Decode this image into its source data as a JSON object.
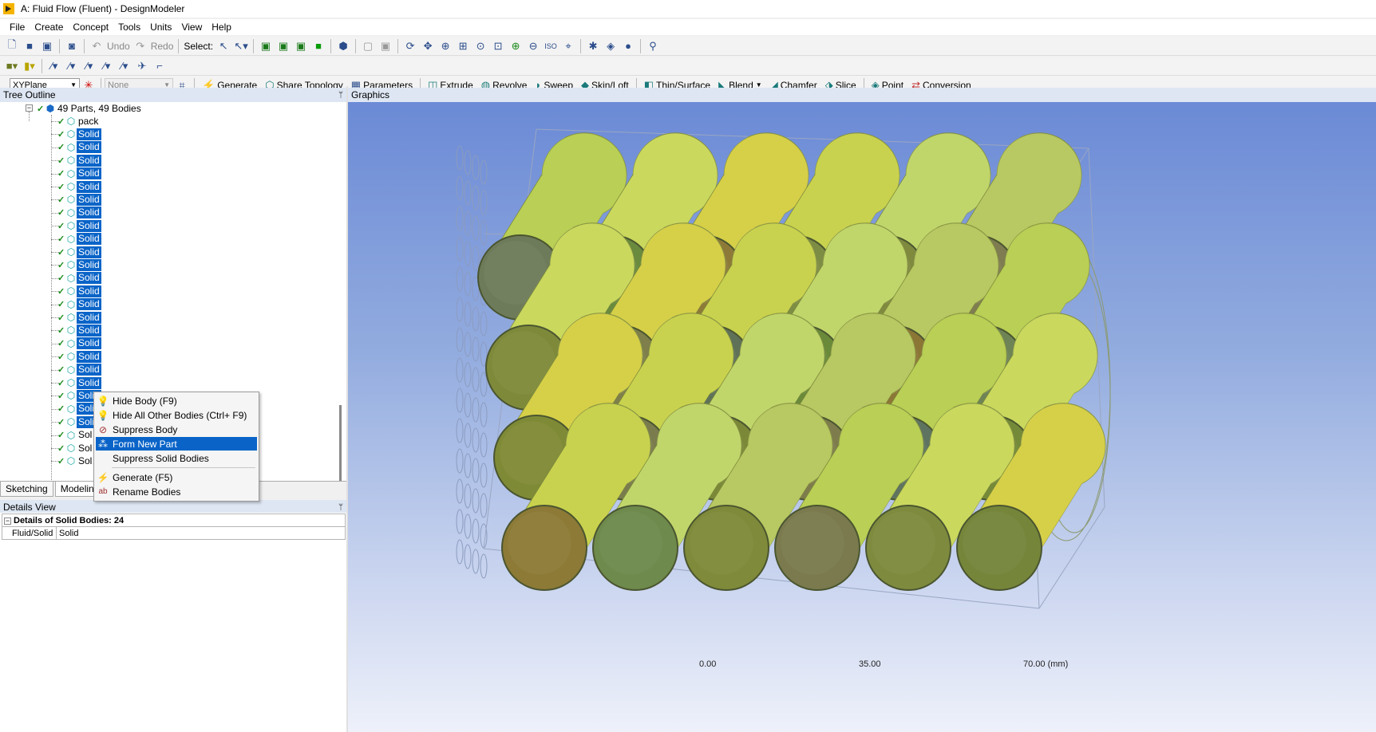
{
  "app": {
    "title": "A: Fluid Flow (Fluent) - DesignModeler"
  },
  "menu": [
    "File",
    "Create",
    "Concept",
    "Tools",
    "Units",
    "View",
    "Help"
  ],
  "toolbar1": {
    "undo_label": "Undo",
    "redo_label": "Redo",
    "select_label": "Select:"
  },
  "toolbar3": {
    "plane_combo": "XYPlane",
    "sketch_combo": "None",
    "buttons": [
      {
        "label": "Generate",
        "icon": "lightning-icon"
      },
      {
        "label": "Share Topology",
        "icon": "share-topology-icon"
      },
      {
        "label": "Parameters",
        "icon": "parameters-icon"
      },
      {
        "label": "Extrude",
        "icon": "extrude-icon"
      },
      {
        "label": "Revolve",
        "icon": "revolve-icon"
      },
      {
        "label": "Sweep",
        "icon": "sweep-icon"
      },
      {
        "label": "Skin/Loft",
        "icon": "skin-loft-icon"
      },
      {
        "label": "Thin/Surface",
        "icon": "thin-surface-icon"
      },
      {
        "label": "Blend",
        "icon": "blend-icon"
      },
      {
        "label": "Chamfer",
        "icon": "chamfer-icon"
      },
      {
        "label": "Slice",
        "icon": "slice-icon"
      },
      {
        "label": "Point",
        "icon": "point-icon"
      },
      {
        "label": "Conversion",
        "icon": "conversion-icon"
      }
    ]
  },
  "tree": {
    "header": "Tree Outline",
    "root_label": "49 Parts, 49 Bodies",
    "first_child": "pack",
    "solid_label": "Solid",
    "truncated_label": "Sol",
    "selected_count": 20,
    "partially_hidden_count": 3,
    "truncated_count": 3
  },
  "tabs": [
    "Sketching",
    "Modeling"
  ],
  "details": {
    "header": "Details View",
    "title": "Details of Solid Bodies: 24",
    "rows": [
      {
        "key": "Fluid/Solid",
        "value": "Solid"
      }
    ]
  },
  "graphics": {
    "header": "Graphics",
    "scale_labels": [
      "0.00",
      "35.00",
      "70.00 (mm)"
    ]
  },
  "context_menu": {
    "items": [
      {
        "label": "Hide Body (F9)",
        "icon": "lightbulb-icon",
        "highlighted": false
      },
      {
        "label": "Hide All Other Bodies (Ctrl+ F9)",
        "icon": "lightbulb-icon",
        "highlighted": false
      },
      {
        "label": "Suppress Body",
        "icon": "suppress-icon",
        "highlighted": false
      },
      {
        "label": "Form New Part",
        "icon": "form-part-icon",
        "highlighted": true
      },
      {
        "label": "Suppress Solid Bodies",
        "icon": "",
        "highlighted": false
      },
      {
        "label": "Generate (F5)",
        "icon": "lightning-icon",
        "highlighted": false
      },
      {
        "label": "Rename Bodies",
        "icon": "rename-icon",
        "highlighted": false
      }
    ]
  }
}
